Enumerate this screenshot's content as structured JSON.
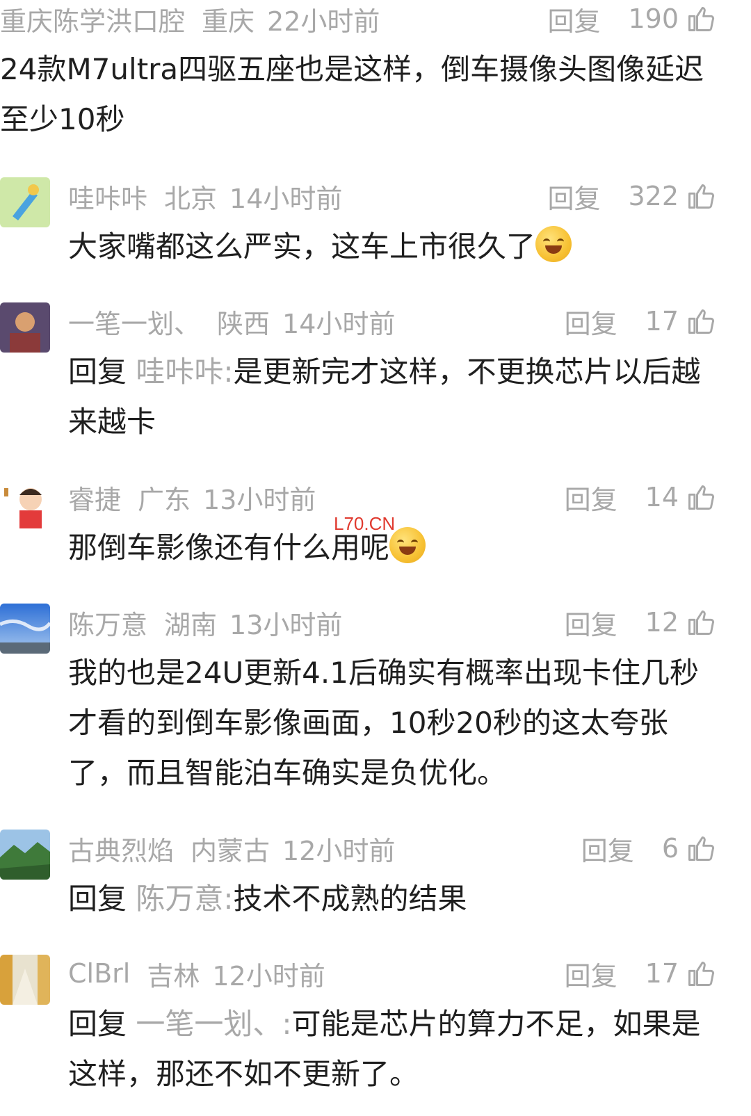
{
  "reply_label": "回复",
  "watermark": "L70.CN",
  "comments": [
    {
      "name": "重庆陈学洪口腔",
      "location": "重庆",
      "time": "22小时前",
      "likes": "190",
      "text": "24款M7ultra四驱五座也是这样，倒车摄像头图像延迟至少10秒"
    },
    {
      "name": "哇咔咔",
      "location": "北京",
      "time": "14小时前",
      "likes": "322",
      "text": "大家嘴都这么严实，这车上市很久了"
    },
    {
      "name": "一笔一划、",
      "location": "陕西",
      "time": "14小时前",
      "likes": "17",
      "reply_to": "哇咔咔:",
      "text": "是更新完才这样，不更换芯片以后越来越卡"
    },
    {
      "name": "睿捷",
      "location": "广东",
      "time": "13小时前",
      "likes": "14",
      "text": "那倒车影像还有什么用呢"
    },
    {
      "name": "陈万意",
      "location": "湖南",
      "time": "13小时前",
      "likes": "12",
      "text": "我的也是24U更新4.1后确实有概率出现卡住几秒才看的到倒车影像画面，10秒20秒的这太夸张了，而且智能泊车确实是负优化。"
    },
    {
      "name": "古典烈焰",
      "location": "内蒙古",
      "time": "12小时前",
      "likes": "6",
      "reply_to": "陈万意:",
      "text": "技术不成熟的结果"
    },
    {
      "name": "ClBrl",
      "location": "吉林",
      "time": "12小时前",
      "likes": "17",
      "reply_to": "一笔一划、:",
      "text": "可能是芯片的算力不足，如果是这样，那还不如不更新了。"
    }
  ]
}
